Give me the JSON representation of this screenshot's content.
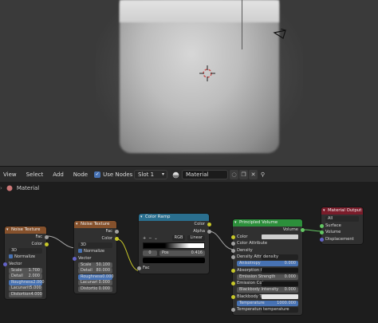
{
  "header": {
    "menus": [
      "View",
      "Select",
      "Add",
      "Node"
    ],
    "use_nodes_label": "Use Nodes",
    "slot": "Slot 1",
    "material_name": "Material"
  },
  "breadcrumb": {
    "label": "Material"
  },
  "nodes": {
    "noise1": {
      "title": "Noise Texture",
      "outputs": [
        "Fac",
        "Color"
      ],
      "dimension": "3D",
      "normalize": "Normalize",
      "vector": "Vector",
      "fields": [
        {
          "label": "Scale",
          "value": "1.700"
        },
        {
          "label": "Detail",
          "value": "2.000"
        },
        {
          "label": "Roughness",
          "value": "2.000"
        },
        {
          "label": "Lacunarit",
          "value": "5.000"
        },
        {
          "label": "Distortion",
          "value": "4.000"
        }
      ]
    },
    "noise2": {
      "title": "Noise Texture",
      "outputs": [
        "Fac",
        "Color"
      ],
      "dimension": "3D",
      "normalize": "Normalize",
      "vector": "Vector",
      "fields": [
        {
          "label": "Scale",
          "value": "50.100"
        },
        {
          "label": "Detail",
          "value": "80.000"
        },
        {
          "label": "Roughness",
          "value": "0.000"
        },
        {
          "label": "Lacunari",
          "value": "0.000"
        },
        {
          "label": "Distortio",
          "value": "0.000"
        }
      ]
    },
    "ramp": {
      "title": "Color Ramp",
      "outputs": [
        "Color",
        "Alpha"
      ],
      "plus": "+",
      "minus": "−",
      "chevron": "⌄",
      "mode": "RGB",
      "interp": "Linear",
      "pos_index": "0",
      "pos_label": "Pos",
      "pos_value": "0.416",
      "input": "Fac"
    },
    "volume": {
      "title": "Principled Volume",
      "output": "Volume",
      "rows": [
        {
          "label": "Color",
          "type": "color"
        },
        {
          "label": "Color Attribute",
          "type": "text"
        },
        {
          "label": "Density",
          "type": "text"
        },
        {
          "label": "Density Attrib...",
          "value": "density",
          "type": "field"
        },
        {
          "label": "Anisotropy",
          "value": "0.000",
          "type": "blue"
        },
        {
          "label": "Absorption C...",
          "type": "field"
        },
        {
          "label": "Emission Strength",
          "value": "0.000",
          "type": "grey"
        },
        {
          "label": "Emission Color",
          "type": "field"
        },
        {
          "label": "Blackbody Intensity",
          "value": "0.000",
          "type": "grey"
        },
        {
          "label": "Blackbody Tint",
          "type": "field"
        },
        {
          "label": "Temperature",
          "value": "1000.000",
          "type": "blue"
        },
        {
          "label": "Temperature ...",
          "value": "temperature",
          "type": "field"
        }
      ]
    },
    "output": {
      "title": "Material Output",
      "target": "All",
      "inputs": [
        "Surface",
        "Volume",
        "Displacement"
      ]
    }
  },
  "colors": {
    "accent": "#4772b3",
    "texture_header": "#85512c",
    "converter_header": "#2a6f8f",
    "shader_header": "#2c8f3b",
    "output_header": "#7a1c2a"
  }
}
